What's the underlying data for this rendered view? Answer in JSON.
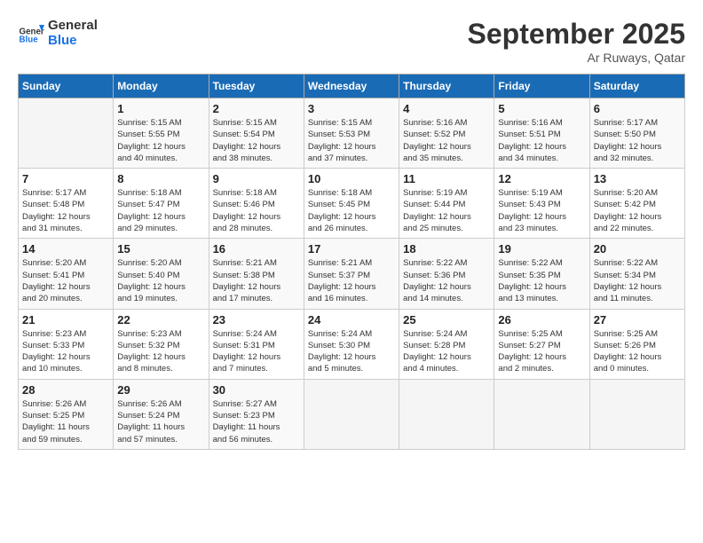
{
  "header": {
    "logo_line1": "General",
    "logo_line2": "Blue",
    "month": "September 2025",
    "location": "Ar Ruways, Qatar"
  },
  "days_of_week": [
    "Sunday",
    "Monday",
    "Tuesday",
    "Wednesday",
    "Thursday",
    "Friday",
    "Saturday"
  ],
  "weeks": [
    [
      {
        "day": "",
        "info": ""
      },
      {
        "day": "1",
        "info": "Sunrise: 5:15 AM\nSunset: 5:55 PM\nDaylight: 12 hours\nand 40 minutes."
      },
      {
        "day": "2",
        "info": "Sunrise: 5:15 AM\nSunset: 5:54 PM\nDaylight: 12 hours\nand 38 minutes."
      },
      {
        "day": "3",
        "info": "Sunrise: 5:15 AM\nSunset: 5:53 PM\nDaylight: 12 hours\nand 37 minutes."
      },
      {
        "day": "4",
        "info": "Sunrise: 5:16 AM\nSunset: 5:52 PM\nDaylight: 12 hours\nand 35 minutes."
      },
      {
        "day": "5",
        "info": "Sunrise: 5:16 AM\nSunset: 5:51 PM\nDaylight: 12 hours\nand 34 minutes."
      },
      {
        "day": "6",
        "info": "Sunrise: 5:17 AM\nSunset: 5:50 PM\nDaylight: 12 hours\nand 32 minutes."
      }
    ],
    [
      {
        "day": "7",
        "info": "Sunrise: 5:17 AM\nSunset: 5:48 PM\nDaylight: 12 hours\nand 31 minutes."
      },
      {
        "day": "8",
        "info": "Sunrise: 5:18 AM\nSunset: 5:47 PM\nDaylight: 12 hours\nand 29 minutes."
      },
      {
        "day": "9",
        "info": "Sunrise: 5:18 AM\nSunset: 5:46 PM\nDaylight: 12 hours\nand 28 minutes."
      },
      {
        "day": "10",
        "info": "Sunrise: 5:18 AM\nSunset: 5:45 PM\nDaylight: 12 hours\nand 26 minutes."
      },
      {
        "day": "11",
        "info": "Sunrise: 5:19 AM\nSunset: 5:44 PM\nDaylight: 12 hours\nand 25 minutes."
      },
      {
        "day": "12",
        "info": "Sunrise: 5:19 AM\nSunset: 5:43 PM\nDaylight: 12 hours\nand 23 minutes."
      },
      {
        "day": "13",
        "info": "Sunrise: 5:20 AM\nSunset: 5:42 PM\nDaylight: 12 hours\nand 22 minutes."
      }
    ],
    [
      {
        "day": "14",
        "info": "Sunrise: 5:20 AM\nSunset: 5:41 PM\nDaylight: 12 hours\nand 20 minutes."
      },
      {
        "day": "15",
        "info": "Sunrise: 5:20 AM\nSunset: 5:40 PM\nDaylight: 12 hours\nand 19 minutes."
      },
      {
        "day": "16",
        "info": "Sunrise: 5:21 AM\nSunset: 5:38 PM\nDaylight: 12 hours\nand 17 minutes."
      },
      {
        "day": "17",
        "info": "Sunrise: 5:21 AM\nSunset: 5:37 PM\nDaylight: 12 hours\nand 16 minutes."
      },
      {
        "day": "18",
        "info": "Sunrise: 5:22 AM\nSunset: 5:36 PM\nDaylight: 12 hours\nand 14 minutes."
      },
      {
        "day": "19",
        "info": "Sunrise: 5:22 AM\nSunset: 5:35 PM\nDaylight: 12 hours\nand 13 minutes."
      },
      {
        "day": "20",
        "info": "Sunrise: 5:22 AM\nSunset: 5:34 PM\nDaylight: 12 hours\nand 11 minutes."
      }
    ],
    [
      {
        "day": "21",
        "info": "Sunrise: 5:23 AM\nSunset: 5:33 PM\nDaylight: 12 hours\nand 10 minutes."
      },
      {
        "day": "22",
        "info": "Sunrise: 5:23 AM\nSunset: 5:32 PM\nDaylight: 12 hours\nand 8 minutes."
      },
      {
        "day": "23",
        "info": "Sunrise: 5:24 AM\nSunset: 5:31 PM\nDaylight: 12 hours\nand 7 minutes."
      },
      {
        "day": "24",
        "info": "Sunrise: 5:24 AM\nSunset: 5:30 PM\nDaylight: 12 hours\nand 5 minutes."
      },
      {
        "day": "25",
        "info": "Sunrise: 5:24 AM\nSunset: 5:28 PM\nDaylight: 12 hours\nand 4 minutes."
      },
      {
        "day": "26",
        "info": "Sunrise: 5:25 AM\nSunset: 5:27 PM\nDaylight: 12 hours\nand 2 minutes."
      },
      {
        "day": "27",
        "info": "Sunrise: 5:25 AM\nSunset: 5:26 PM\nDaylight: 12 hours\nand 0 minutes."
      }
    ],
    [
      {
        "day": "28",
        "info": "Sunrise: 5:26 AM\nSunset: 5:25 PM\nDaylight: 11 hours\nand 59 minutes."
      },
      {
        "day": "29",
        "info": "Sunrise: 5:26 AM\nSunset: 5:24 PM\nDaylight: 11 hours\nand 57 minutes."
      },
      {
        "day": "30",
        "info": "Sunrise: 5:27 AM\nSunset: 5:23 PM\nDaylight: 11 hours\nand 56 minutes."
      },
      {
        "day": "",
        "info": ""
      },
      {
        "day": "",
        "info": ""
      },
      {
        "day": "",
        "info": ""
      },
      {
        "day": "",
        "info": ""
      }
    ]
  ]
}
